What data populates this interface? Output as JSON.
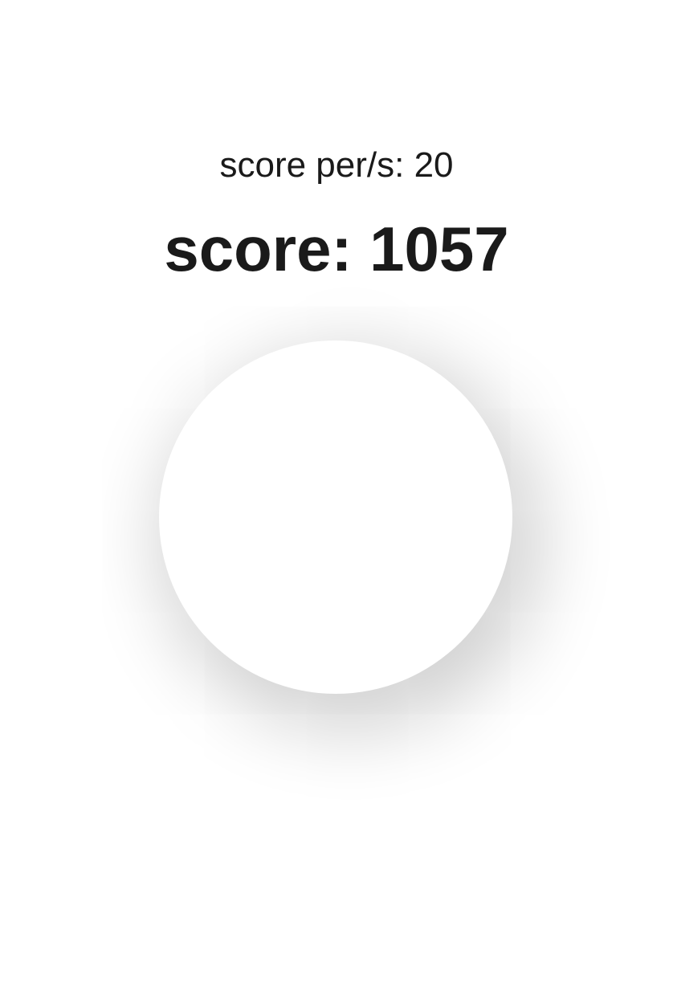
{
  "game": {
    "score_per_second_text": "score per/s: 20",
    "score_text": "score: 1057",
    "score_per_second": 20,
    "score": 1057
  },
  "colors": {
    "background": "#ffffff",
    "text": "#1a1a1a",
    "circle": "#ffffff"
  }
}
